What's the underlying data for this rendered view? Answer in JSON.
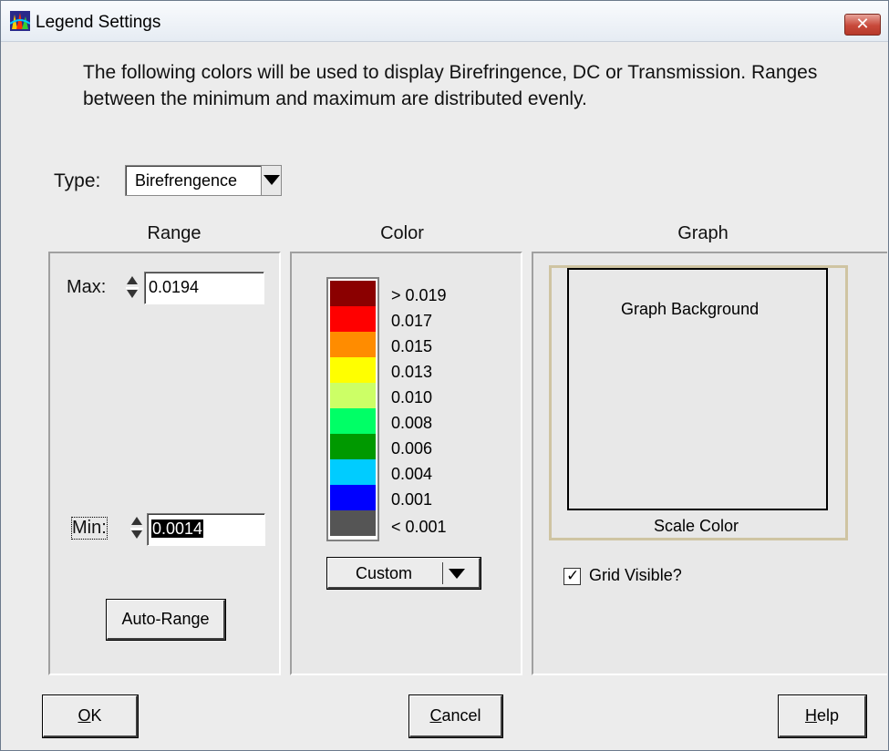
{
  "window": {
    "title": "Legend Settings",
    "close_glyph": "✕"
  },
  "description": "The following colors will be used to display Birefringence, DC or Transmission.  Ranges between the minimum and maximum are distributed evenly.",
  "type": {
    "label": "Type:",
    "value": "Birefrengence"
  },
  "sections": {
    "range": "Range",
    "color": "Color",
    "graph": "Graph"
  },
  "range": {
    "max_label": "Max:",
    "max_value": "0.0194",
    "min_label": "Min:",
    "min_value": "0.0014",
    "auto_range_label": "Auto-Range"
  },
  "color": {
    "swatches": [
      "#8b0000",
      "#ff0000",
      "#ff8c00",
      "#ffff00",
      "#ccff66",
      "#00ff66",
      "#009900",
      "#00ccff",
      "#0000ff",
      "#555555"
    ],
    "labels": [
      "> 0.019",
      "0.017",
      "0.015",
      "0.013",
      "0.010",
      "0.008",
      "0.006",
      "0.004",
      "0.001",
      "< 0.001"
    ],
    "scheme": "Custom"
  },
  "graph": {
    "background_label": "Graph Background",
    "scale_color_label": "Scale Color",
    "grid_visible_label": "Grid Visible?",
    "grid_visible": true
  },
  "buttons": {
    "ok_underlined": "O",
    "ok_rest": "K",
    "cancel_underlined": "C",
    "cancel_rest": "ancel",
    "help_underlined": "H",
    "help_rest": "elp"
  }
}
